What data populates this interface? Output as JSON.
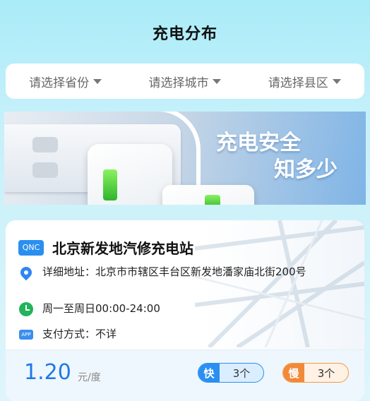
{
  "header": {
    "title": "充电分布"
  },
  "filters": [
    {
      "label": "请选择省份"
    },
    {
      "label": "请选择城市"
    },
    {
      "label": "请选择县区"
    }
  ],
  "banner": {
    "line1": "充电安全",
    "line2": "知多少"
  },
  "station": {
    "logo": "QNC",
    "name": "北京新发地汽修充电站",
    "address_label": "详细地址：",
    "address": "北京市市辖区丰台区新发地潘家庙北街200号",
    "hours": "周一至周日00:00-24:00",
    "payment_label": "支付方式：",
    "payment": "不详",
    "price": "1.20",
    "price_unit": "元/度",
    "fast": {
      "tag": "快",
      "count": "3个"
    },
    "slow": {
      "tag": "慢",
      "count": "3个"
    }
  },
  "colors": {
    "accent": "#2a8ff0",
    "price": "#1f78e6",
    "slow": "#f2893a",
    "clock": "#22b35c"
  }
}
